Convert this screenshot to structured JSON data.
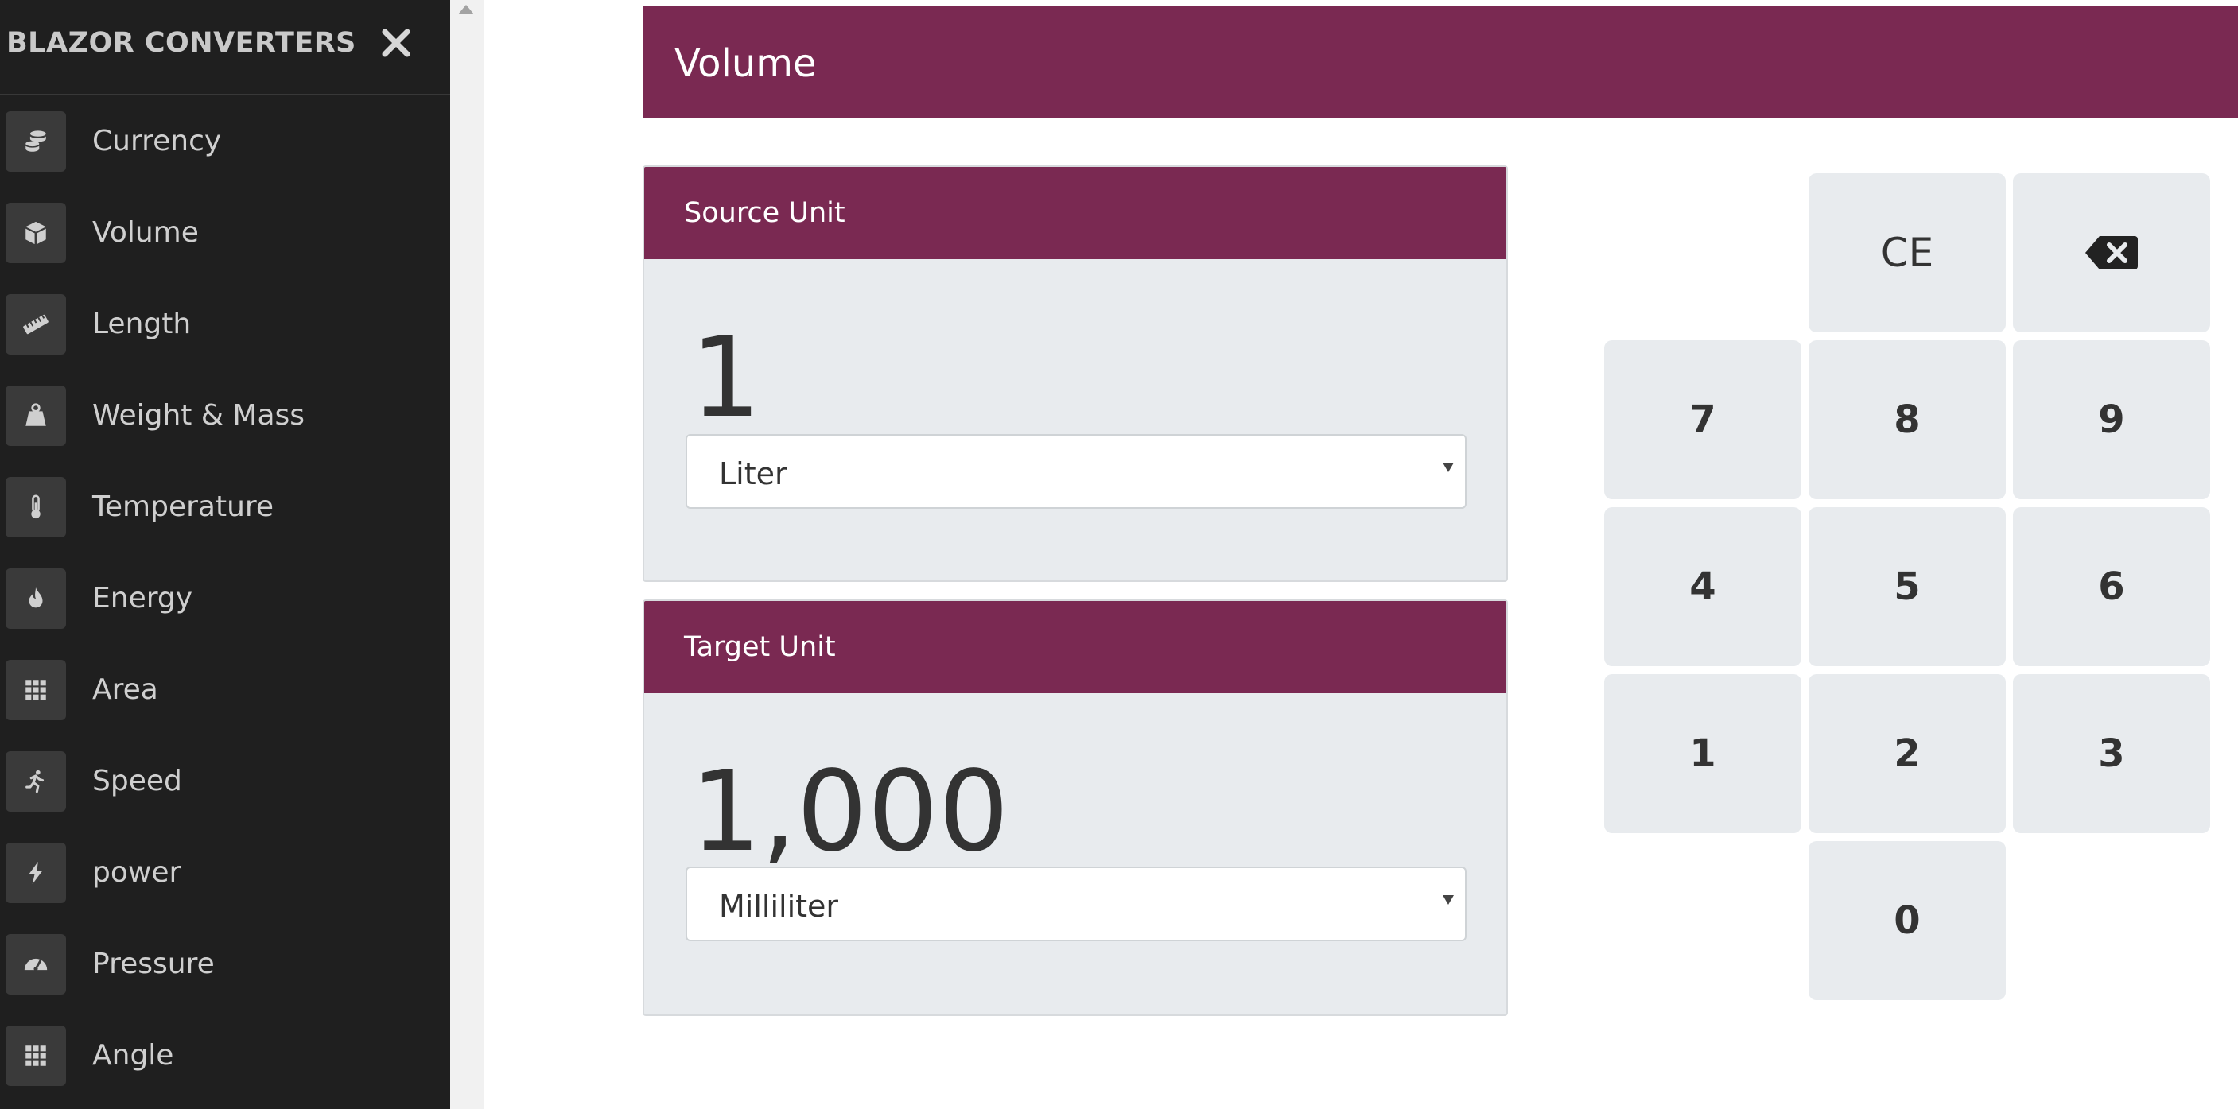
{
  "sidebar": {
    "title": "BLAZOR CONVERTERS",
    "close_icon": "close-icon",
    "items": [
      {
        "label": "Currency",
        "icon": "coins-icon"
      },
      {
        "label": "Volume",
        "icon": "cube-icon"
      },
      {
        "label": "Length",
        "icon": "ruler-icon"
      },
      {
        "label": "Weight & Mass",
        "icon": "weight-icon"
      },
      {
        "label": "Temperature",
        "icon": "thermometer-icon"
      },
      {
        "label": "Energy",
        "icon": "fire-icon"
      },
      {
        "label": "Area",
        "icon": "grid-icon"
      },
      {
        "label": "Speed",
        "icon": "running-icon"
      },
      {
        "label": "power",
        "icon": "bolt-icon"
      },
      {
        "label": "Pressure",
        "icon": "gauge-icon"
      },
      {
        "label": "Angle",
        "icon": "grid-icon"
      }
    ]
  },
  "page": {
    "title": "Volume"
  },
  "source": {
    "header": "Source Unit",
    "value": "1",
    "unit": "Liter"
  },
  "target": {
    "header": "Target Unit",
    "value": "1,000",
    "unit": "Milliliter"
  },
  "keypad": {
    "ce": "CE",
    "backspace_icon": "backspace-icon",
    "k7": "7",
    "k8": "8",
    "k9": "9",
    "k4": "4",
    "k5": "5",
    "k6": "6",
    "k1": "1",
    "k2": "2",
    "k3": "3",
    "k0": "0"
  },
  "colors": {
    "accent": "#7a2952",
    "sidebar_bg": "#1f1f1f",
    "panel_bg": "#e8ebee"
  }
}
